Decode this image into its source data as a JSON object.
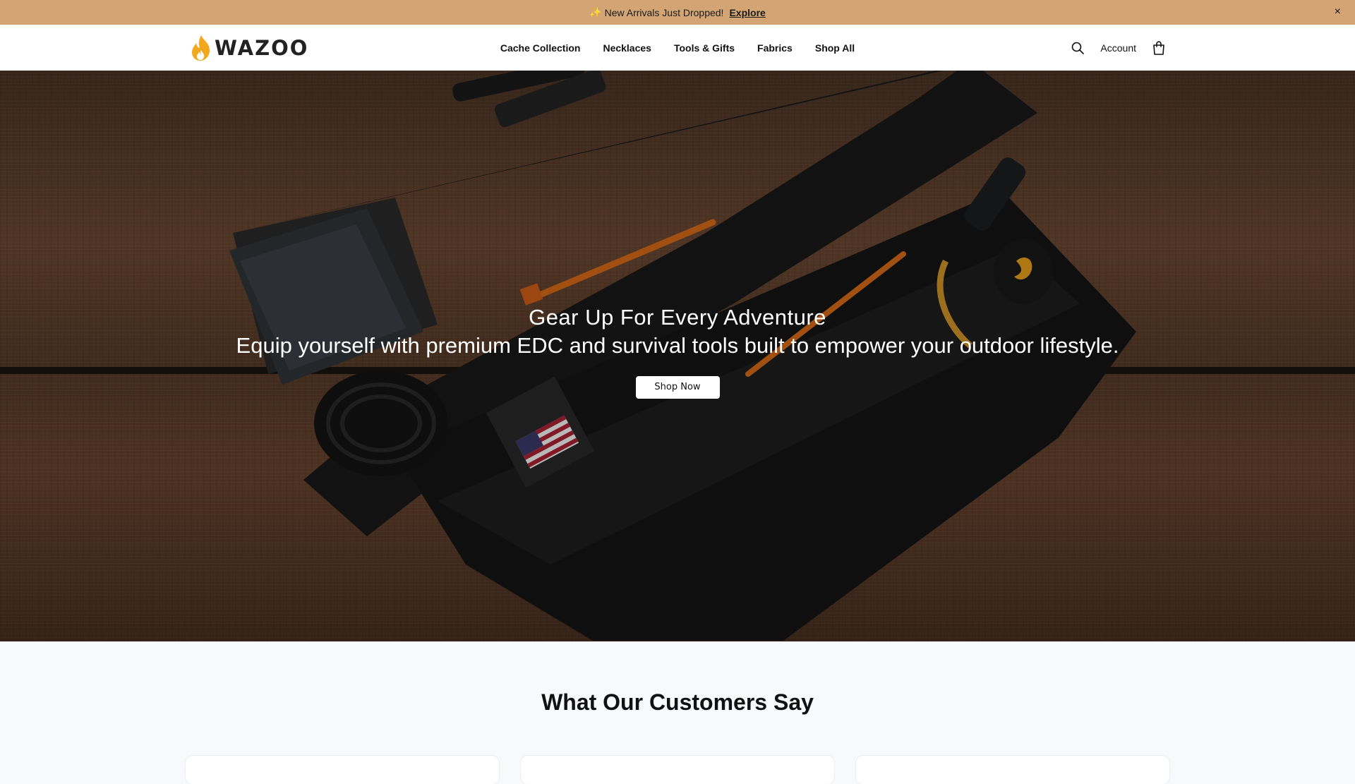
{
  "announcement": {
    "sparkle": "✨",
    "text": "New Arrivals Just Dropped!",
    "link_label": "Explore",
    "close_glyph": "×"
  },
  "header": {
    "logo_text": "WAZOO",
    "nav": [
      "Cache Collection",
      "Necklaces",
      "Tools & Gifts",
      "Fabrics",
      "Shop All"
    ],
    "account_label": "Account",
    "icons": [
      "search-icon",
      "bag-icon"
    ]
  },
  "hero": {
    "title": "Gear Up For Every Adventure",
    "subtitle": "Equip yourself with premium EDC and survival tools built to empower your outdoor lifestyle.",
    "cta_label": "Shop Now"
  },
  "testimonials": {
    "heading": "What Our Customers Say"
  },
  "colors": {
    "announcement_bg": "#d4a574",
    "logo_flame": "#f2a81d",
    "cta_bg": "#ffffff"
  }
}
